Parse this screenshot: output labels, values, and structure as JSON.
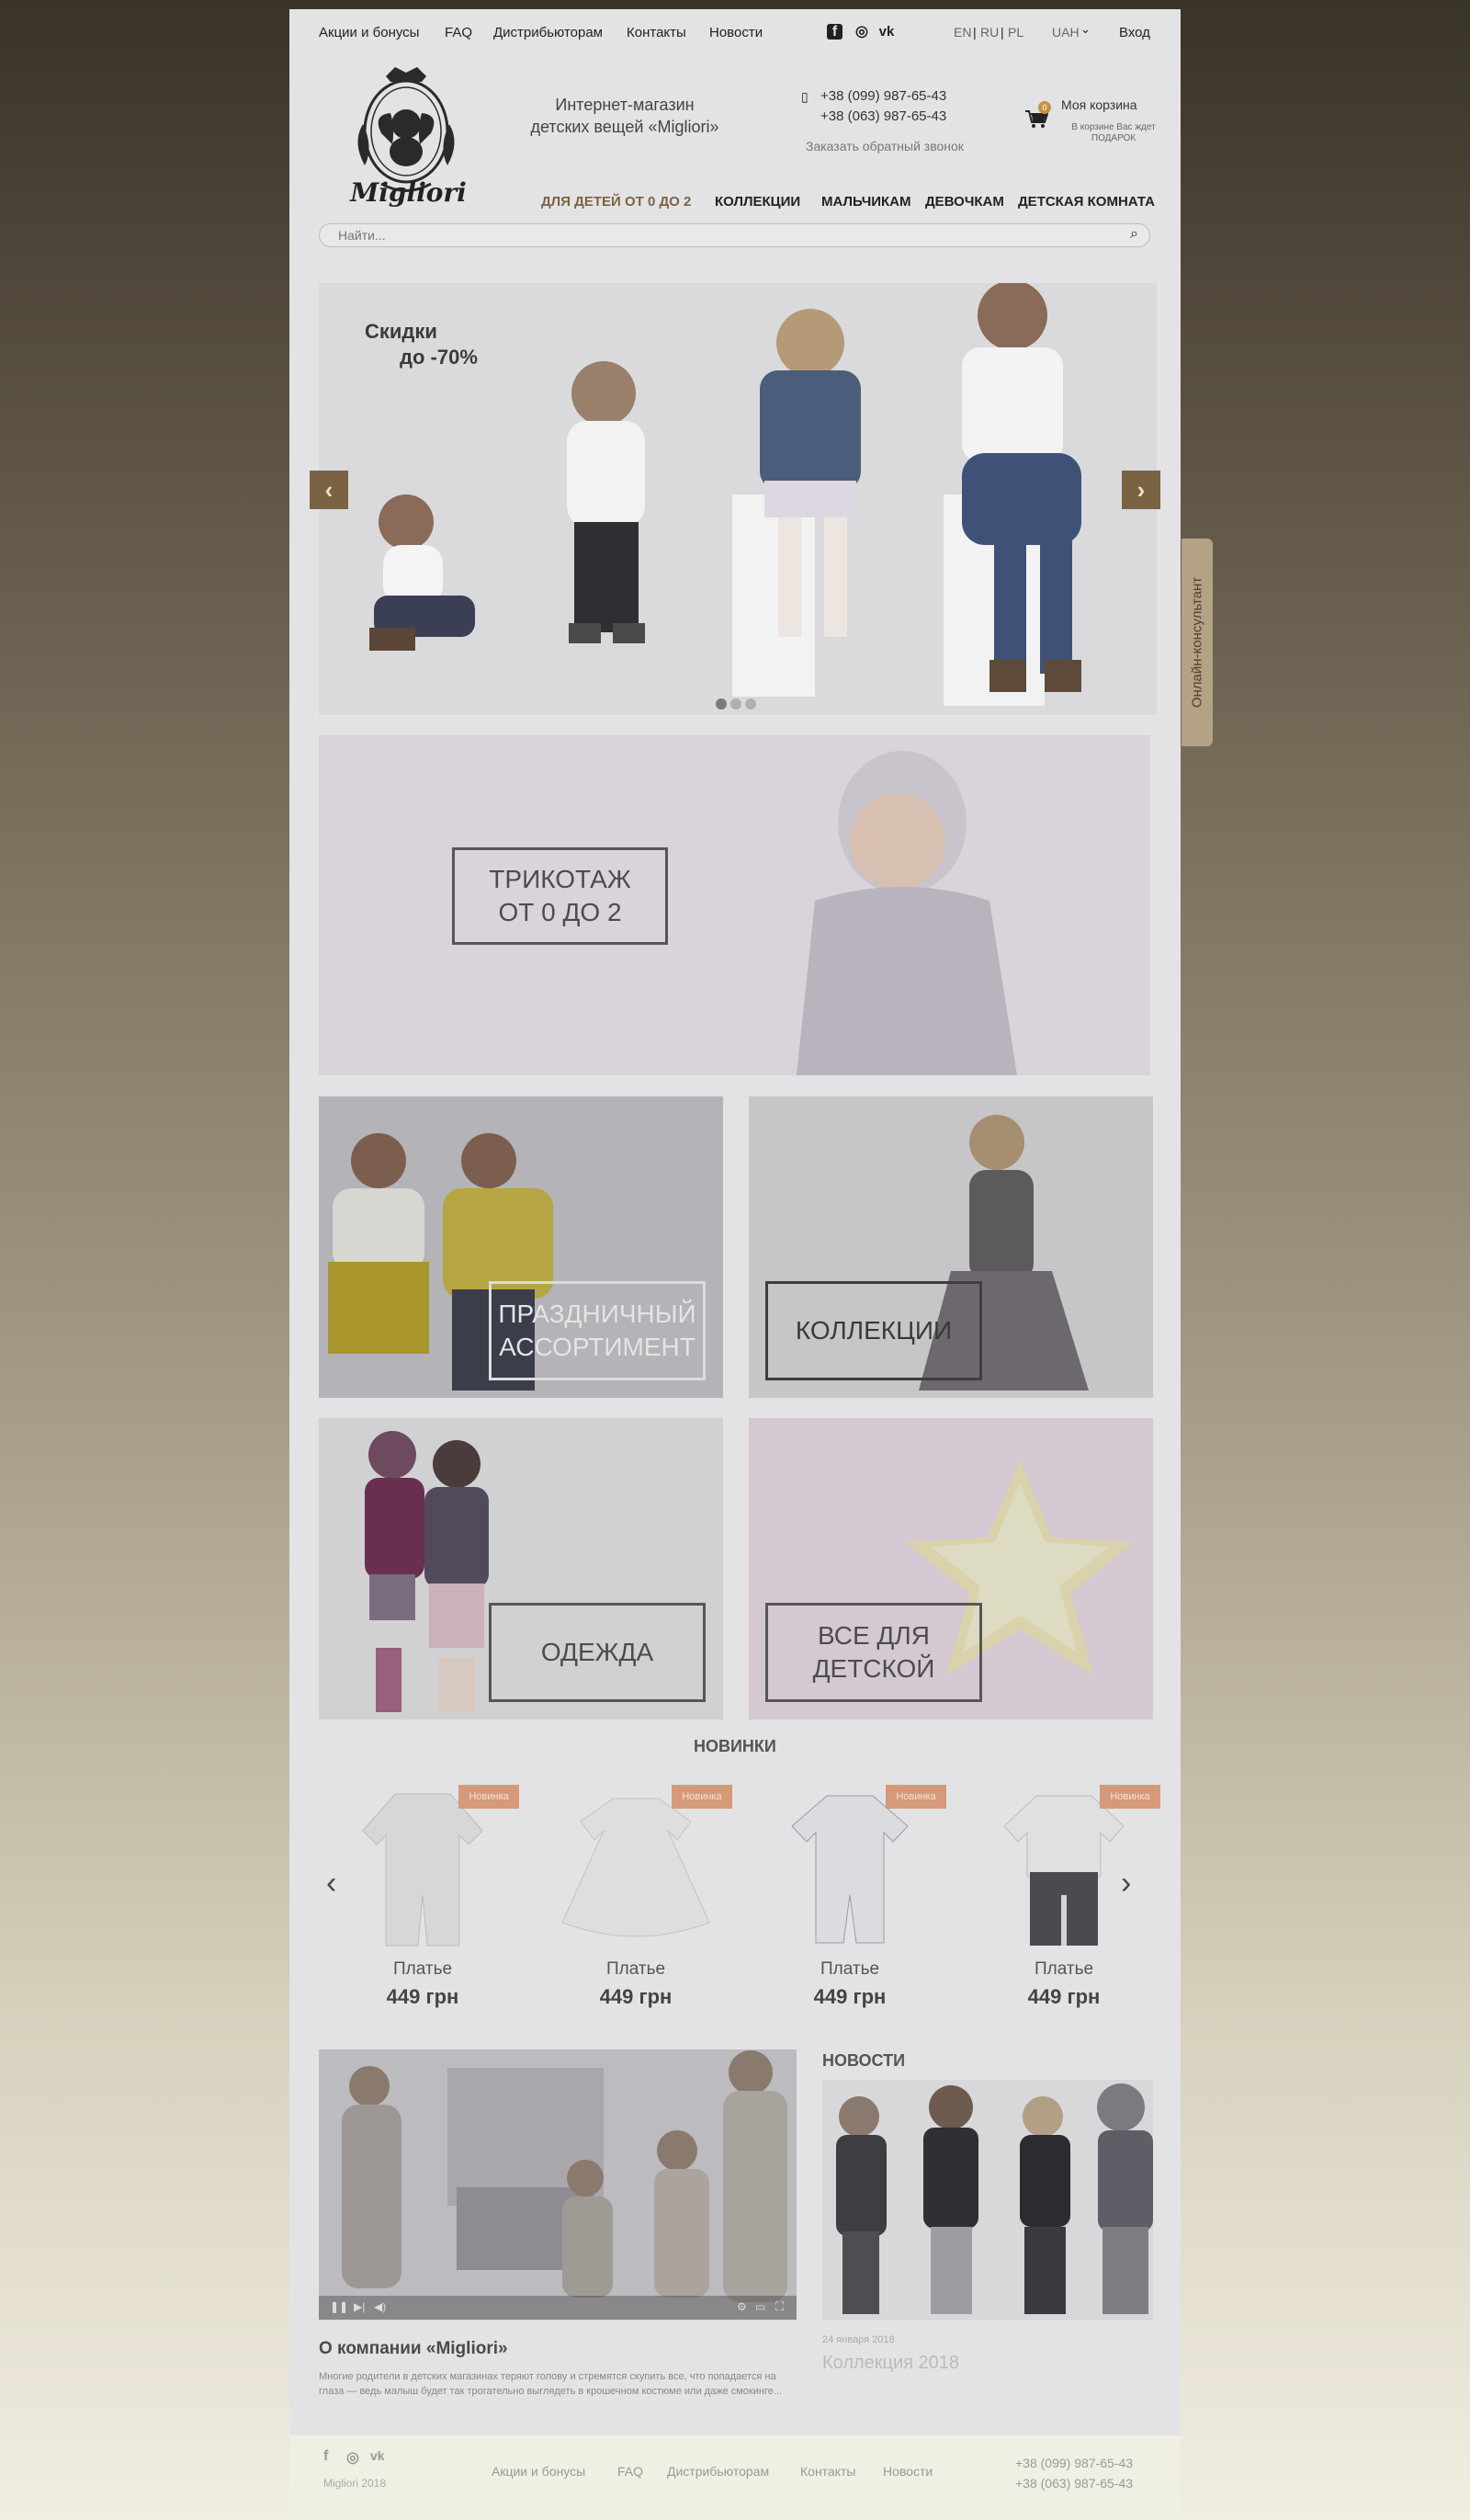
{
  "topbar": {
    "links": [
      "Акции и бонусы",
      "FAQ",
      "Дистрибьюторам",
      "Контакты",
      "Новости"
    ],
    "social": [
      {
        "icon": "facebook-icon",
        "glyph": "f"
      },
      {
        "icon": "instagram-icon",
        "glyph": "◎"
      },
      {
        "icon": "vk-icon",
        "glyph": "vk"
      }
    ],
    "languages": [
      "EN",
      "RU",
      "PL"
    ],
    "currency": "UAH",
    "login": "Вход"
  },
  "header": {
    "logo_text": "Migliori",
    "shop_title_line1": "Интернет-магазин",
    "shop_title_line2": "детских вещей «Migliori»",
    "phones": [
      "+38 (099) 987-65-43",
      "+38 (063) 987-65-43"
    ],
    "callback": "Заказать обратный звонок",
    "cart_label": "Моя корзина",
    "cart_count": "0",
    "cart_note": "В корзине Вас ждет ПОДАРОК"
  },
  "nav": {
    "items": [
      "ДЛЯ ДЕТЕЙ ОТ 0 ДО 2",
      "КОЛЛЕКЦИИ",
      "МАЛЬЧИКАМ",
      "ДЕВОЧКАМ",
      "ДЕТСКАЯ КОМНАТА"
    ],
    "active_color": "#7a6342"
  },
  "search": {
    "placeholder": "Найти..."
  },
  "slider": {
    "text_line1": "Скидки",
    "text_line2": "до -70%",
    "dots": 3,
    "active_dot": 0
  },
  "consultant": {
    "label": "Онлайн-консультант"
  },
  "banners": {
    "knit": {
      "line1": "ТРИКОТАЖ",
      "line2": "ОТ 0 ДО 2"
    },
    "festive": {
      "line1": "ПРАЗДНИЧНЫЙ",
      "line2": "АССОРТИМЕНТ"
    },
    "collections": {
      "line1": "КОЛЛЕКЦИИ"
    },
    "clothes": {
      "line1": "ОДЕЖДА"
    },
    "nursery": {
      "line1": "ВСЕ ДЛЯ",
      "line2": "ДЕТСКОЙ"
    }
  },
  "new_products": {
    "title": "НОВИНКИ",
    "items": [
      {
        "badge": "Новинка",
        "name": "Платье",
        "price": "449 грн"
      },
      {
        "badge": "Новинка",
        "name": "Платье",
        "price": "449 грн"
      },
      {
        "badge": "Новинка",
        "name": "Платье",
        "price": "449 грн"
      },
      {
        "badge": "Новинка",
        "name": "Платье",
        "price": "449 грн"
      }
    ]
  },
  "about": {
    "title": "О компании «Migliori»",
    "text": "Многие родители в детских магазинах теряют голову и стремятся скупить все, что попадается на глаза — ведь малыш будет так трогательно выглядеть в крошечном костюме или даже смокинге..."
  },
  "news": {
    "title": "НОВОСТИ",
    "date": "24 января 2018",
    "headline": "Коллекция 2018"
  },
  "footer": {
    "copyright": "Migliori 2018",
    "links": [
      "Акции и бонусы",
      "FAQ",
      "Дистрибьюторам",
      "Контакты",
      "Новости"
    ],
    "phones": [
      "+38 (099) 987-65-43",
      "+38 (063) 987-65-43"
    ]
  }
}
